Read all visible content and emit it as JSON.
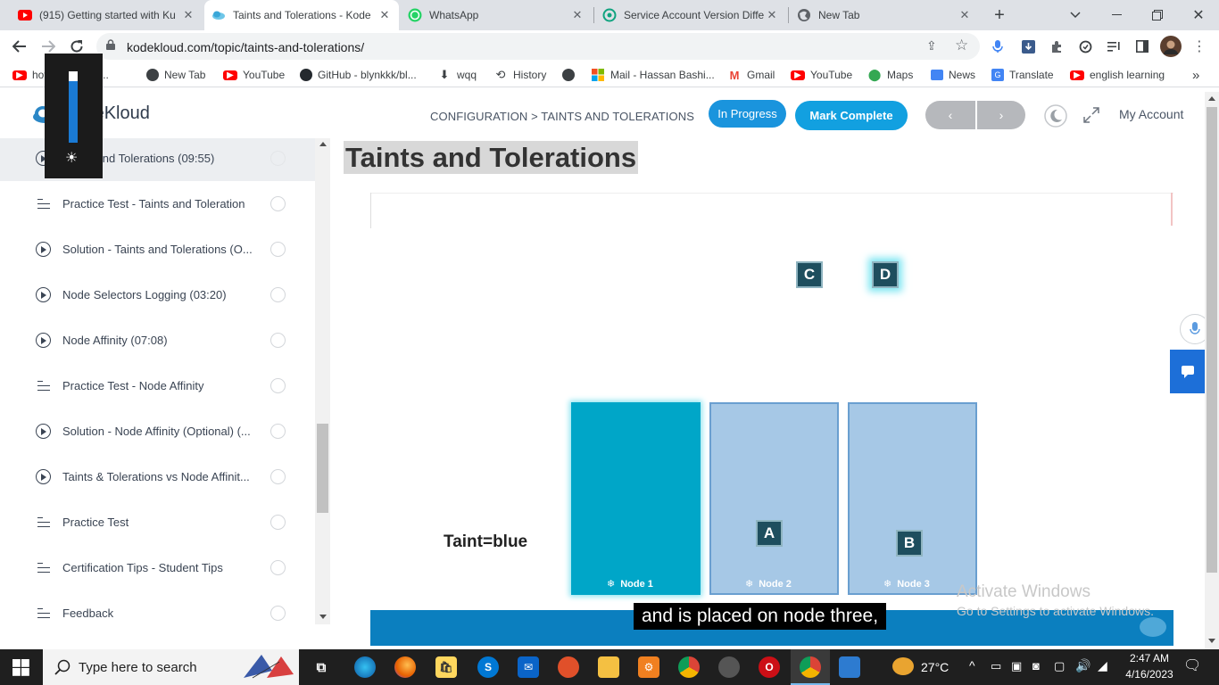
{
  "browser": {
    "tabs": [
      {
        "title": "(915) Getting started with Ku",
        "icon": "youtube-icon",
        "active": false
      },
      {
        "title": "Taints and Tolerations - Kode",
        "icon": "kodekloud-icon",
        "active": true
      },
      {
        "title": "WhatsApp",
        "icon": "whatsapp-icon",
        "active": false
      },
      {
        "title": "Service Account Version Diffe",
        "icon": "chatgpt-icon",
        "active": false
      },
      {
        "title": "New Tab",
        "icon": "globe-icon",
        "active": false
      }
    ],
    "url": "kodekloud.com/topic/taints-and-tolerations/",
    "bookmarks": [
      "hot girl | urdu i...",
      "New Tab",
      "YouTube",
      "GitHub - blynkkk/bl...",
      "wqq",
      "History",
      "",
      "Mail - Hassan Bashi...",
      "Gmail",
      "YouTube",
      "Maps",
      "News",
      "Translate",
      "english learning"
    ]
  },
  "site": {
    "logo_text": "KodeKloud",
    "breadcrumb": "CONFIGURATION > TAINTS AND TOLERATIONS",
    "status_label": "In Progress",
    "mark_complete_label": "Mark Complete",
    "prev_label": "‹",
    "next_label": "›",
    "account_label": "My Account",
    "accent_color": "#0095db"
  },
  "sidebar": {
    "items": [
      {
        "label": "Taints and Tolerations (09:55)",
        "type": "video",
        "active": true
      },
      {
        "label": "Practice Test - Taints and Toleration",
        "type": "doc"
      },
      {
        "label": "Solution - Taints and Tolerations (O...",
        "type": "video"
      },
      {
        "label": "Node Selectors Logging (03:20)",
        "type": "video"
      },
      {
        "label": "Node Affinity (07:08)",
        "type": "video"
      },
      {
        "label": "Practice Test - Node Affinity",
        "type": "doc"
      },
      {
        "label": "Solution - Node Affinity (Optional) (...",
        "type": "video"
      },
      {
        "label": "Taints & Tolerations vs Node Affinit...",
        "type": "video"
      },
      {
        "label": "Practice Test",
        "type": "doc"
      },
      {
        "label": "Certification Tips - Student Tips",
        "type": "doc"
      },
      {
        "label": "Feedback",
        "type": "doc"
      }
    ]
  },
  "page": {
    "title": "Taints and Tolerations"
  },
  "video": {
    "pods": [
      "C",
      "D",
      "A",
      "B"
    ],
    "taint_label": "Taint=blue",
    "nodes": [
      "Node 1",
      "Node 2",
      "Node 3"
    ],
    "caption": "and is placed on node three,"
  },
  "watermark": {
    "line1": "Activate Windows",
    "line2": "Go to Settings to activate Windows."
  },
  "taskbar": {
    "search_placeholder": "Type here to search",
    "weather": "27°C",
    "time": "2:47 AM",
    "date": "4/16/2023"
  }
}
